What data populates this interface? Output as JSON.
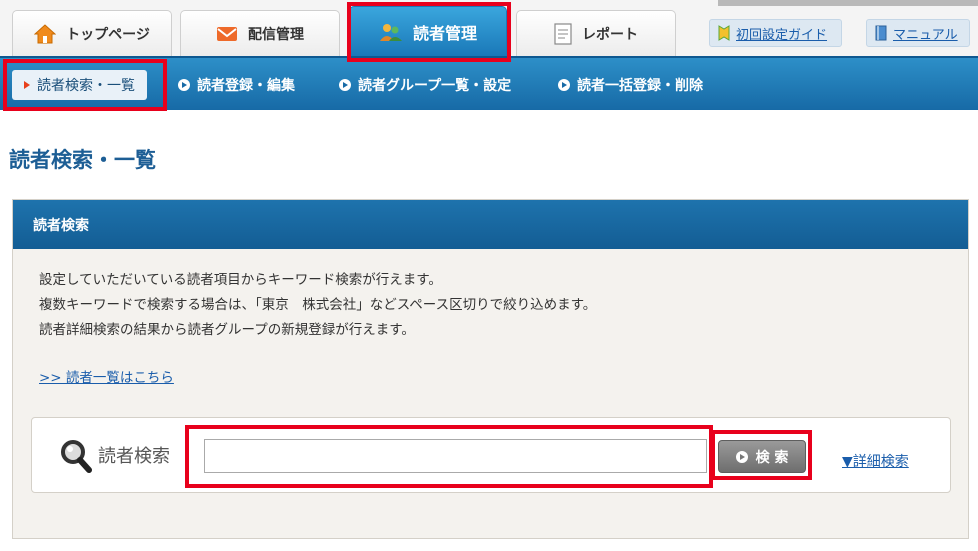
{
  "tabs": [
    {
      "label": "トップページ",
      "icon": "home-icon"
    },
    {
      "label": "配信管理",
      "icon": "mail-icon"
    },
    {
      "label": "読者管理",
      "icon": "users-icon",
      "active": true
    },
    {
      "label": "レポート",
      "icon": "report-icon"
    }
  ],
  "guides": {
    "setup_label": "初回設定ガイド",
    "manual_label": "マニュアル"
  },
  "subnav": [
    {
      "label": "読者検索・一覧",
      "current": true
    },
    {
      "label": "読者登録・編集"
    },
    {
      "label": "読者グループ一覧・設定"
    },
    {
      "label": "読者一括登録・削除"
    }
  ],
  "page": {
    "title": "読者検索・一覧"
  },
  "panel": {
    "heading": "読者検索",
    "description": [
      "設定していただいている読者項目からキーワード検索が行えます。",
      "複数キーワードで検索する場合は、「東京　株式会社」などスペース区切りで絞り込めます。",
      "読者詳細検索の結果から読者グループの新規登録が行えます。"
    ],
    "list_link": ">> 読者一覧はこちら"
  },
  "search": {
    "label": "読者検索",
    "value": "",
    "button_label": "検 索",
    "detail_link": "▼詳細検索"
  },
  "colors": {
    "highlight": "#e8001c",
    "nav_blue": "#176aa6",
    "title_blue": "#1d5e95"
  }
}
